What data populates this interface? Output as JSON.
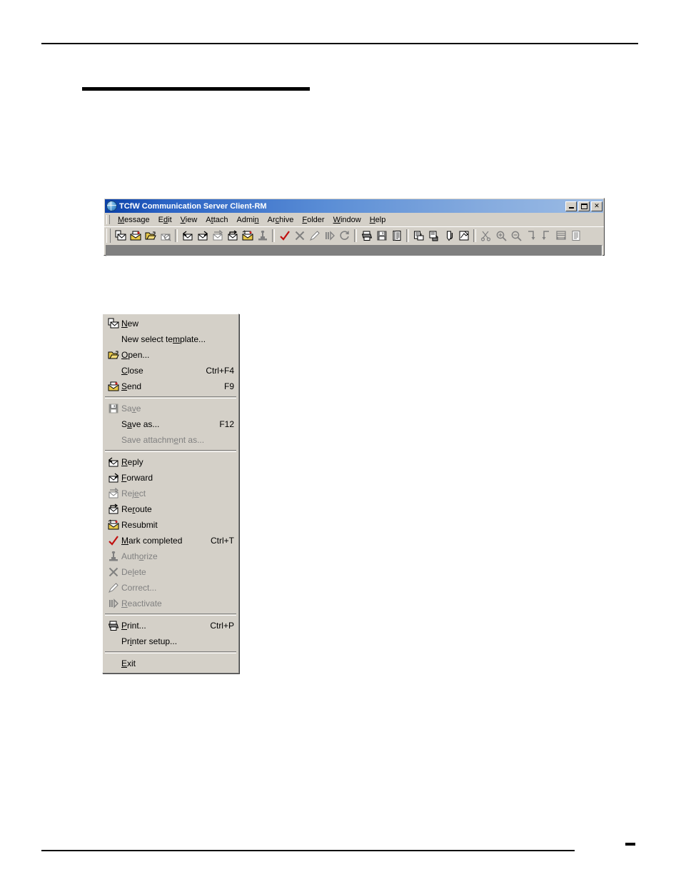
{
  "page": {
    "top_rule": true,
    "bottom_rule": true,
    "heading_rule": true,
    "page_dash": "-"
  },
  "window": {
    "title": "TCfW Communication Server Client-RM",
    "title_icon": "globe-icon",
    "controls": [
      {
        "name": "minimize-button",
        "glyph": "_"
      },
      {
        "name": "maximize-button",
        "glyph": "□"
      },
      {
        "name": "close-button",
        "glyph": "×"
      }
    ]
  },
  "menubar": {
    "items": [
      {
        "label": "Message",
        "accel_index": 0
      },
      {
        "label": "Edit",
        "accel_index": 1
      },
      {
        "label": "View",
        "accel_index": 0
      },
      {
        "label": "Attach",
        "accel_index": 1
      },
      {
        "label": "Admin",
        "accel_index": 4
      },
      {
        "label": "Archive",
        "accel_index": 2
      },
      {
        "label": "Folder",
        "accel_index": 0
      },
      {
        "label": "Window",
        "accel_index": 0
      },
      {
        "label": "Help",
        "accel_index": 0
      }
    ]
  },
  "toolbar": {
    "groups": [
      {
        "buttons": [
          {
            "name": "new-message-icon",
            "tip": "New"
          },
          {
            "name": "send-message-icon",
            "tip": "Send"
          },
          {
            "name": "open-folder-icon",
            "tip": "Open"
          },
          {
            "name": "search-message-icon",
            "tip": "Find"
          }
        ]
      },
      {
        "buttons": [
          {
            "name": "reply-icon",
            "tip": "Reply"
          },
          {
            "name": "forward-icon",
            "tip": "Forward"
          },
          {
            "name": "reject-icon",
            "tip": "Reject"
          },
          {
            "name": "reroute-icon",
            "tip": "Reroute"
          },
          {
            "name": "resubmit-icon",
            "tip": "Resubmit"
          },
          {
            "name": "authorize-stamp-icon",
            "tip": "Authorize"
          }
        ]
      },
      {
        "buttons": [
          {
            "name": "mark-completed-check-icon",
            "tip": "Mark completed"
          },
          {
            "name": "delete-x-icon",
            "tip": "Delete"
          },
          {
            "name": "correct-pencil-icon",
            "tip": "Correct"
          },
          {
            "name": "reactivate-icon",
            "tip": "Reactivate"
          },
          {
            "name": "refresh-icon",
            "tip": "Refresh"
          }
        ]
      },
      {
        "buttons": [
          {
            "name": "print-icon",
            "tip": "Print"
          },
          {
            "name": "save-icon",
            "tip": "Save"
          },
          {
            "name": "report-icon",
            "tip": "Report"
          }
        ]
      },
      {
        "buttons": [
          {
            "name": "copy-to-folder-icon",
            "tip": "Copy to folder"
          },
          {
            "name": "move-to-folder-icon",
            "tip": "Move to folder"
          },
          {
            "name": "attach-icon",
            "tip": "Attach"
          },
          {
            "name": "edit-note-icon",
            "tip": "Edit note"
          }
        ]
      },
      {
        "buttons": [
          {
            "name": "cut-scissors-icon",
            "tip": "Cut"
          },
          {
            "name": "zoom-in-icon",
            "tip": "Zoom in"
          },
          {
            "name": "zoom-out-icon",
            "tip": "Zoom out"
          },
          {
            "name": "next-item-icon",
            "tip": "Next"
          },
          {
            "name": "previous-item-icon",
            "tip": "Previous"
          },
          {
            "name": "fit-width-icon",
            "tip": "Fit width"
          },
          {
            "name": "list-view-icon",
            "tip": "List view"
          }
        ]
      }
    ]
  },
  "dropdown": {
    "name": "message-menu",
    "items": [
      {
        "type": "item",
        "label": "New",
        "accel": "N",
        "accel_index": 0,
        "shortcut": "",
        "icon": "new-message-icon",
        "disabled": false
      },
      {
        "type": "item",
        "label": "New select template...",
        "accel": "m",
        "accel_index": 13,
        "shortcut": "",
        "icon": "",
        "disabled": false
      },
      {
        "type": "item",
        "label": "Open...",
        "accel": "O",
        "accel_index": 0,
        "shortcut": "",
        "icon": "open-folder-icon",
        "disabled": false
      },
      {
        "type": "item",
        "label": "Close",
        "accel": "C",
        "accel_index": 0,
        "shortcut": "Ctrl+F4",
        "icon": "",
        "disabled": false
      },
      {
        "type": "item",
        "label": "Send",
        "accel": "S",
        "accel_index": 0,
        "shortcut": "F9",
        "icon": "send-message-icon",
        "disabled": false
      },
      {
        "type": "separator"
      },
      {
        "type": "item",
        "label": "Save",
        "accel": "v",
        "accel_index": 2,
        "shortcut": "",
        "icon": "save-icon",
        "disabled": true
      },
      {
        "type": "item",
        "label": "Save as...",
        "accel": "a",
        "accel_index": 1,
        "shortcut": "F12",
        "icon": "",
        "disabled": false
      },
      {
        "type": "item",
        "label": "Save attachment as...",
        "accel": "h",
        "accel_index": 12,
        "shortcut": "",
        "icon": "",
        "disabled": true
      },
      {
        "type": "separator"
      },
      {
        "type": "item",
        "label": "Reply",
        "accel": "R",
        "accel_index": 0,
        "shortcut": "",
        "icon": "reply-icon",
        "disabled": false
      },
      {
        "type": "item",
        "label": "Forward",
        "accel": "F",
        "accel_index": 0,
        "shortcut": "",
        "icon": "forward-icon",
        "disabled": false
      },
      {
        "type": "item",
        "label": "Reject",
        "accel": "j",
        "accel_index": 3,
        "shortcut": "",
        "icon": "reject-icon",
        "disabled": true
      },
      {
        "type": "item",
        "label": "Reroute",
        "accel": "r",
        "accel_index": 2,
        "shortcut": "",
        "icon": "reroute-icon",
        "disabled": false
      },
      {
        "type": "item",
        "label": "Resubmit",
        "accel": "",
        "accel_index": -1,
        "shortcut": "",
        "icon": "resubmit-icon",
        "disabled": false
      },
      {
        "type": "item",
        "label": "Mark completed",
        "accel": "M",
        "accel_index": 0,
        "shortcut": "Ctrl+T",
        "icon": "mark-completed-check-icon",
        "disabled": false
      },
      {
        "type": "item",
        "label": "Authorize",
        "accel": "h",
        "accel_index": 4,
        "shortcut": "",
        "icon": "authorize-stamp-icon",
        "disabled": true
      },
      {
        "type": "item",
        "label": "Delete",
        "accel": "l",
        "accel_index": 2,
        "shortcut": "",
        "icon": "delete-x-icon",
        "disabled": true
      },
      {
        "type": "item",
        "label": "Correct...",
        "accel": "",
        "accel_index": -1,
        "shortcut": "",
        "icon": "correct-pencil-icon",
        "disabled": true
      },
      {
        "type": "item",
        "label": "Reactivate",
        "accel": "R",
        "accel_index": 0,
        "shortcut": "",
        "icon": "reactivate-icon",
        "disabled": true
      },
      {
        "type": "separator"
      },
      {
        "type": "item",
        "label": "Print...",
        "accel": "P",
        "accel_index": 0,
        "shortcut": "Ctrl+P",
        "icon": "print-icon",
        "disabled": false
      },
      {
        "type": "item",
        "label": "Printer setup...",
        "accel": "r",
        "accel_index": 2,
        "shortcut": "",
        "icon": "",
        "disabled": false
      },
      {
        "type": "separator"
      },
      {
        "type": "item",
        "label": "Exit",
        "accel": "E",
        "accel_index": 0,
        "shortcut": "",
        "icon": "",
        "disabled": false
      }
    ]
  },
  "colors": {
    "window_face": "#d4d0c8",
    "title_bar_start": "#0a40a8",
    "title_bar_end": "#9cbce5",
    "client_area": "#808080",
    "disabled_text": "#808080",
    "text": "#000000"
  }
}
